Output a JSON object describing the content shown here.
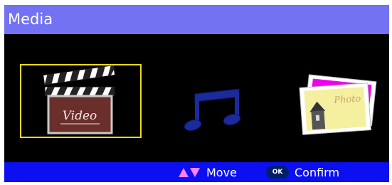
{
  "header": {
    "title": "Media"
  },
  "menu": {
    "items": [
      {
        "id": "video",
        "icon": "clapperboard-icon",
        "icon_text": "Video",
        "selected": true
      },
      {
        "id": "music",
        "icon": "music-note-icon",
        "selected": false
      },
      {
        "id": "photo",
        "icon": "photo-icon",
        "icon_text": "Photo",
        "selected": false
      }
    ]
  },
  "footer": {
    "move_label": "Move",
    "ok_key_label": "OK",
    "confirm_label": "Confirm"
  },
  "colors": {
    "header_bg": "#7272f2",
    "footer_bg": "#0c10f0",
    "selection_border": "#ecd91a",
    "arrow_color": "#ff80ff",
    "ok_key_bg": "#001f6a"
  }
}
